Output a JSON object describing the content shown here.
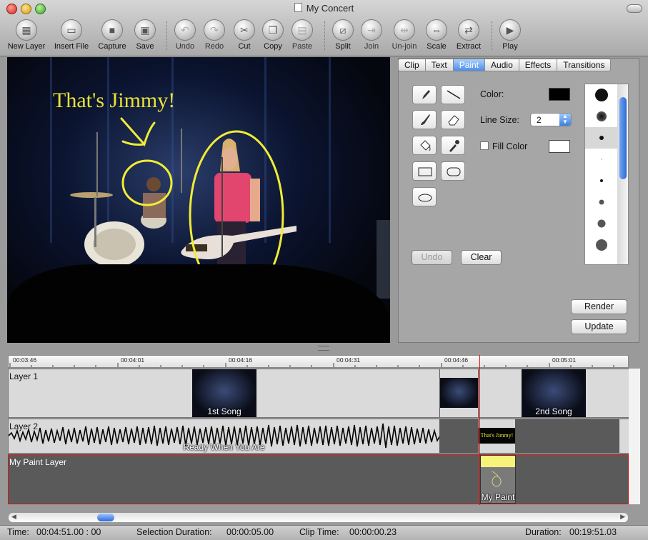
{
  "window": {
    "title": "My Concert"
  },
  "toolbar": {
    "new_layer": "New Layer",
    "insert_file": "Insert File",
    "capture": "Capture",
    "save": "Save",
    "undo": "Undo",
    "redo": "Redo",
    "cut": "Cut",
    "copy": "Copy",
    "paste": "Paste",
    "split": "Split",
    "join": "Join",
    "unjoin": "Un-join",
    "scale": "Scale",
    "extract": "Extract",
    "play": "Play"
  },
  "preview": {
    "overlay_text": "That's Jimmy!"
  },
  "inspector": {
    "tabs": [
      "Clip",
      "Text",
      "Paint",
      "Audio",
      "Effects",
      "Transitions"
    ],
    "active_tab": "Paint",
    "color_label": "Color:",
    "line_size_label": "Line Size:",
    "line_size_value": "2",
    "fill_color_label": "Fill Color",
    "undo_label": "Undo",
    "clear_label": "Clear",
    "render_label": "Render",
    "update_label": "Update",
    "color_value": "#000000",
    "fill_color_value": "#ffffff",
    "brush_sizes": [
      18,
      14,
      6,
      1,
      4,
      7,
      11,
      16,
      4
    ]
  },
  "timeline": {
    "ruler_ticks": [
      "00:03:46",
      "00:04:01",
      "00:04:16",
      "00:04:31",
      "00:04:46",
      "00:05:01"
    ],
    "tracks": {
      "layer1": {
        "label": "Layer 1",
        "clip1": "1st Song",
        "clip2": "2nd Song"
      },
      "layer2": {
        "label": "Layer 2",
        "audio_clip": "Ready When You Are",
        "text_clip": "That's Jimmy!"
      },
      "paint": {
        "label": "My Paint Layer",
        "clip": "My Paint"
      }
    }
  },
  "status": {
    "time_label": "Time:",
    "time_value": "00:04:51.00 : 00",
    "selection_label": "Selection Duration:",
    "selection_value": "00:00:05.00",
    "clip_time_label": "Clip Time:",
    "clip_time_value": "00:00:00.23",
    "duration_label": "Duration:",
    "duration_value": "00:19:51.03"
  }
}
